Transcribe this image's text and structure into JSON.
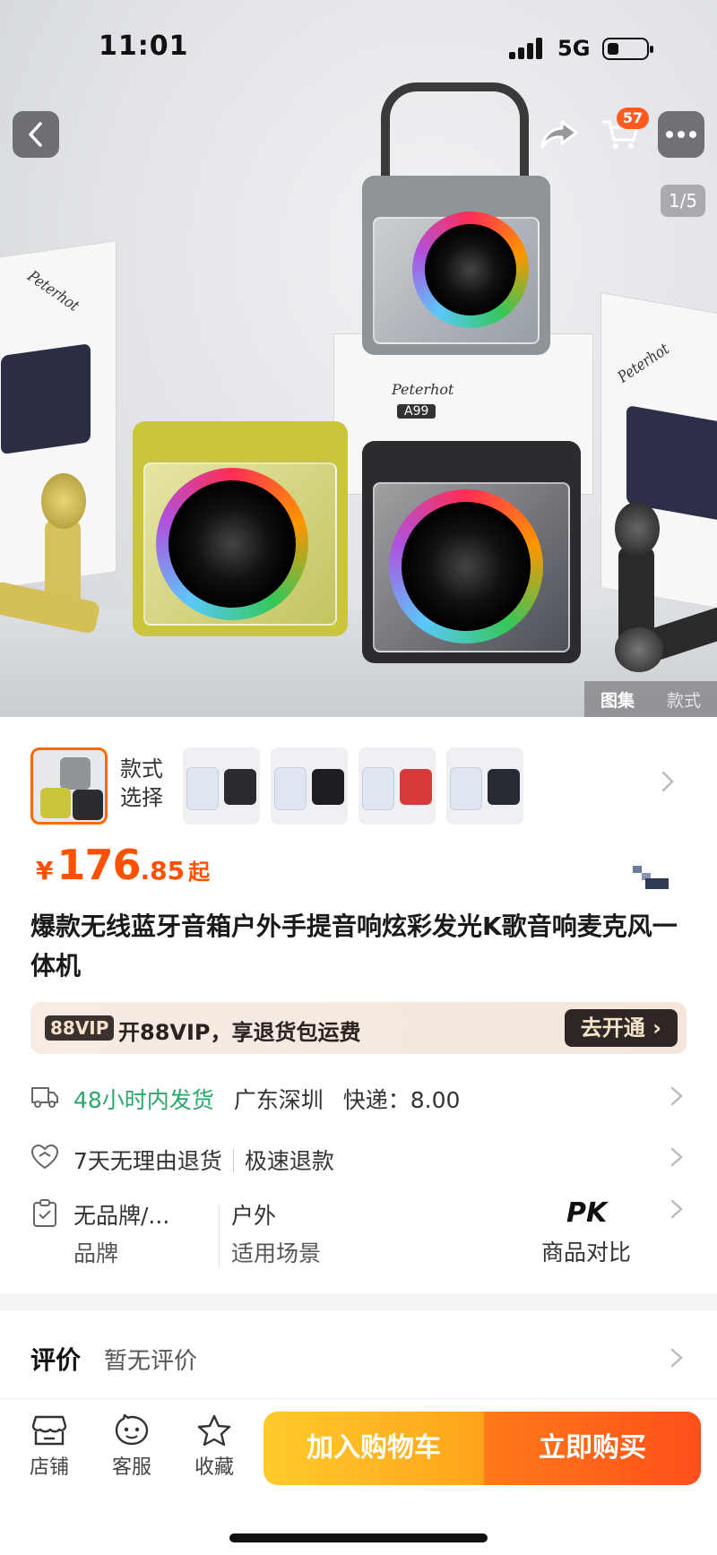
{
  "status_bar": {
    "time": "11:01",
    "network": "5G"
  },
  "nav": {
    "cart_count": "57",
    "image_counter": "1/5"
  },
  "gallery_tabs": {
    "active": "图集",
    "inactive": "款式"
  },
  "product_art": {
    "brand": "Peterhot",
    "model": "A99"
  },
  "sku": {
    "label_line1": "款式",
    "label_line2": "选择"
  },
  "price": {
    "currency": "¥",
    "integer": "176",
    "decimal": ".85",
    "suffix": "起"
  },
  "title": "爆款无线蓝牙音箱户外手提音响炫彩发光K歌音响麦克风一体机",
  "vip": {
    "tag": "88VIP",
    "text": "开88VIP，享退货包运费",
    "button": "去开通"
  },
  "shipping": {
    "highlight": "48小时内发货",
    "origin": "广东深圳",
    "express": "快递：8.00"
  },
  "service": {
    "return": "7天无理由退货",
    "refund": "极速退款"
  },
  "attributes": {
    "brand_value": "无品牌/...",
    "brand_label": "品牌",
    "scene_value": "户外",
    "scene_label": "适用场景",
    "compare_icon": "PK",
    "compare_label": "商品对比"
  },
  "review": {
    "heading": "评价",
    "value": "暂无评价"
  },
  "bottom_bar": {
    "shop": "店铺",
    "service": "客服",
    "favorite": "收藏",
    "add_to_cart": "加入购物车",
    "buy_now": "立即购买"
  },
  "colors": {
    "accent": "#ff5000",
    "green": "#2aa86a",
    "cart_btn": "#ffb020",
    "buy_btn": "#ff5a1a"
  }
}
